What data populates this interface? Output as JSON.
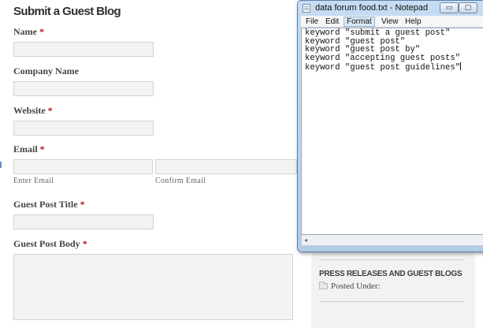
{
  "form": {
    "title": "Submit a Guest Blog",
    "required_marker": "*",
    "name_label": "Name",
    "company_label": "Company Name",
    "website_label": "Website",
    "email_label": "Email",
    "enter_email_label": "Enter Email",
    "confirm_email_label": "Confirm Email",
    "post_title_label": "Guest Post Title",
    "post_body_label": "Guest Post Body"
  },
  "sidebar": {
    "heading": "PRESS RELEASES AND GUEST BLOGS",
    "posted_under": "Posted Under:"
  },
  "notepad": {
    "title": "data forum food.txt - Notepad",
    "minimize_glyph": "▭",
    "maximize_glyph": "▢",
    "scroll_left_glyph": "◂",
    "menu": [
      "File",
      "Edit",
      "Format",
      "View",
      "Help"
    ],
    "active_menu": "Format",
    "lines": [
      "keyword \"submit a guest post\"",
      "keyword \"guest post\"",
      "keyword \"guest post by\"",
      "keyword \"accepting guest posts\"",
      "keyword \"guest post guidelines\""
    ]
  }
}
